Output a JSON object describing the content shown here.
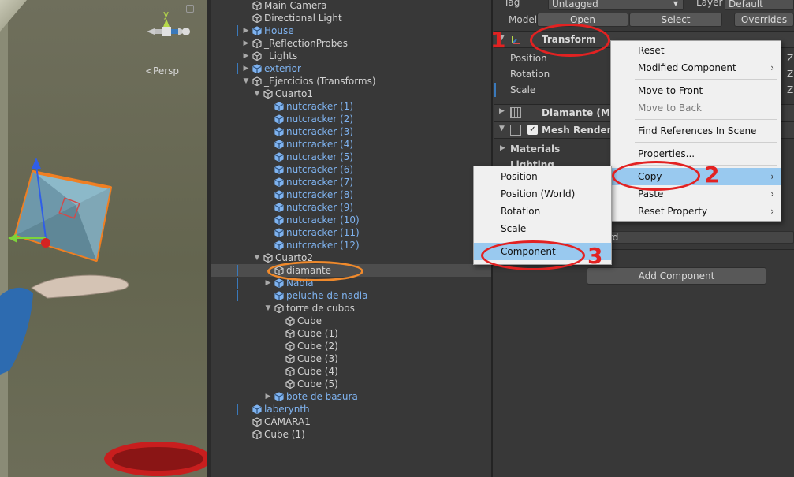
{
  "scene": {
    "view_label": "<Persp",
    "gizmo_icon": "scene-orientation-gizmo",
    "gizmo_axis_y": "y"
  },
  "hierarchy": {
    "items": [
      {
        "label": "Main Camera",
        "indent": 0,
        "arrow": "",
        "prefab": false,
        "mark": false
      },
      {
        "label": "Directional Light",
        "indent": 0,
        "arrow": "",
        "prefab": false,
        "mark": false
      },
      {
        "label": "House",
        "indent": 0,
        "arrow": "▶",
        "prefab": true,
        "mark": true
      },
      {
        "label": "_ReflectionProbes",
        "indent": 0,
        "arrow": "▶",
        "prefab": false,
        "mark": false
      },
      {
        "label": "_Lights",
        "indent": 0,
        "arrow": "▶",
        "prefab": false,
        "mark": false
      },
      {
        "label": "exterior",
        "indent": 0,
        "arrow": "▶",
        "prefab": true,
        "mark": true
      },
      {
        "label": "_Ejercicios (Transforms)",
        "indent": 0,
        "arrow": "▼",
        "prefab": false,
        "mark": false
      },
      {
        "label": "Cuarto1",
        "indent": 1,
        "arrow": "▼",
        "prefab": false,
        "mark": false
      },
      {
        "label": "nutcracker (1)",
        "indent": 2,
        "arrow": "",
        "prefab": true,
        "mark": false
      },
      {
        "label": "nutcracker (2)",
        "indent": 2,
        "arrow": "",
        "prefab": true,
        "mark": false
      },
      {
        "label": "nutcracker (3)",
        "indent": 2,
        "arrow": "",
        "prefab": true,
        "mark": false
      },
      {
        "label": "nutcracker (4)",
        "indent": 2,
        "arrow": "",
        "prefab": true,
        "mark": false
      },
      {
        "label": "nutcracker (5)",
        "indent": 2,
        "arrow": "",
        "prefab": true,
        "mark": false
      },
      {
        "label": "nutcracker (6)",
        "indent": 2,
        "arrow": "",
        "prefab": true,
        "mark": false
      },
      {
        "label": "nutcracker (7)",
        "indent": 2,
        "arrow": "",
        "prefab": true,
        "mark": false
      },
      {
        "label": "nutcracker (8)",
        "indent": 2,
        "arrow": "",
        "prefab": true,
        "mark": false
      },
      {
        "label": "nutcracker (9)",
        "indent": 2,
        "arrow": "",
        "prefab": true,
        "mark": false
      },
      {
        "label": "nutcracker (10)",
        "indent": 2,
        "arrow": "",
        "prefab": true,
        "mark": false
      },
      {
        "label": "nutcracker (11)",
        "indent": 2,
        "arrow": "",
        "prefab": true,
        "mark": false
      },
      {
        "label": "nutcracker (12)",
        "indent": 2,
        "arrow": "",
        "prefab": true,
        "mark": false
      },
      {
        "label": "Cuarto2",
        "indent": 1,
        "arrow": "▼",
        "prefab": false,
        "mark": false
      },
      {
        "label": "diamante",
        "indent": 2,
        "arrow": "",
        "prefab": false,
        "mark": true,
        "selected": true
      },
      {
        "label": "Nadia",
        "indent": 2,
        "arrow": "▶",
        "prefab": true,
        "mark": true
      },
      {
        "label": "peluche de nadia",
        "indent": 2,
        "arrow": "",
        "prefab": true,
        "mark": true
      },
      {
        "label": "torre de cubos",
        "indent": 2,
        "arrow": "▼",
        "prefab": false,
        "mark": false
      },
      {
        "label": "Cube",
        "indent": 3,
        "arrow": "",
        "prefab": false,
        "mark": false
      },
      {
        "label": "Cube (1)",
        "indent": 3,
        "arrow": "",
        "prefab": false,
        "mark": false
      },
      {
        "label": "Cube (2)",
        "indent": 3,
        "arrow": "",
        "prefab": false,
        "mark": false
      },
      {
        "label": "Cube (3)",
        "indent": 3,
        "arrow": "",
        "prefab": false,
        "mark": false
      },
      {
        "label": "Cube (4)",
        "indent": 3,
        "arrow": "",
        "prefab": false,
        "mark": false
      },
      {
        "label": "Cube (5)",
        "indent": 3,
        "arrow": "",
        "prefab": false,
        "mark": false
      },
      {
        "label": "bote de basura",
        "indent": 2,
        "arrow": "▶",
        "prefab": true,
        "mark": false
      },
      {
        "label": "laberynth",
        "indent": 0,
        "arrow": "",
        "prefab": true,
        "mark": true
      },
      {
        "label": "CÁMARA1",
        "indent": 0,
        "arrow": "",
        "prefab": false,
        "mark": false
      },
      {
        "label": "Cube (1)",
        "indent": 0,
        "arrow": "",
        "prefab": false,
        "mark": false
      }
    ]
  },
  "inspector": {
    "tag_label": "Tag",
    "tag_value": "Untagged",
    "layer_label": "Layer",
    "layer_value": "Default",
    "model_label": "Model",
    "open_button": "Open",
    "select_button": "Select",
    "overrides_button": "Overrides",
    "transform_title": "Transform",
    "position_label": "Position",
    "rotation_label": "Rotation",
    "scale_label": "Scale",
    "z_label": "Z",
    "mesh_filter_title": "Diamante (Mes",
    "mesh_renderer_title": "Mesh Renderer",
    "materials_label": "Materials",
    "lighting_label": "Lighting",
    "shader_partial": "rd",
    "add_component_button": "Add Component"
  },
  "context_menu": {
    "items": [
      {
        "label": "Reset",
        "disabled": false,
        "submenu": false
      },
      {
        "label": "Modified Component",
        "disabled": false,
        "submenu": true
      },
      {
        "label": "Move to Front",
        "disabled": false,
        "submenu": false
      },
      {
        "label": "Move to Back",
        "disabled": true,
        "submenu": false
      },
      {
        "label": "Find References In Scene",
        "disabled": false,
        "submenu": false
      },
      {
        "label": "Properties...",
        "disabled": false,
        "submenu": false
      },
      {
        "label": "Copy",
        "disabled": false,
        "submenu": true,
        "highlight": true
      },
      {
        "label": "Paste",
        "disabled": false,
        "submenu": true
      },
      {
        "label": "Reset Property",
        "disabled": false,
        "submenu": true
      }
    ]
  },
  "copy_submenu": {
    "items": [
      {
        "label": "Position",
        "highlight": false
      },
      {
        "label": "Position (World)",
        "highlight": false
      },
      {
        "label": "Rotation",
        "highlight": false
      },
      {
        "label": "Scale",
        "highlight": false
      },
      {
        "label": "Component",
        "highlight": true
      }
    ]
  },
  "annotations": {
    "step1": "1",
    "step2": "2",
    "step3": "3",
    "red": "#e22222",
    "orange": "#f08a2c"
  },
  "colors": {
    "prefab_text": "#7fb3f0",
    "highlight": "#99c9ef",
    "panel_bg": "#383838"
  }
}
